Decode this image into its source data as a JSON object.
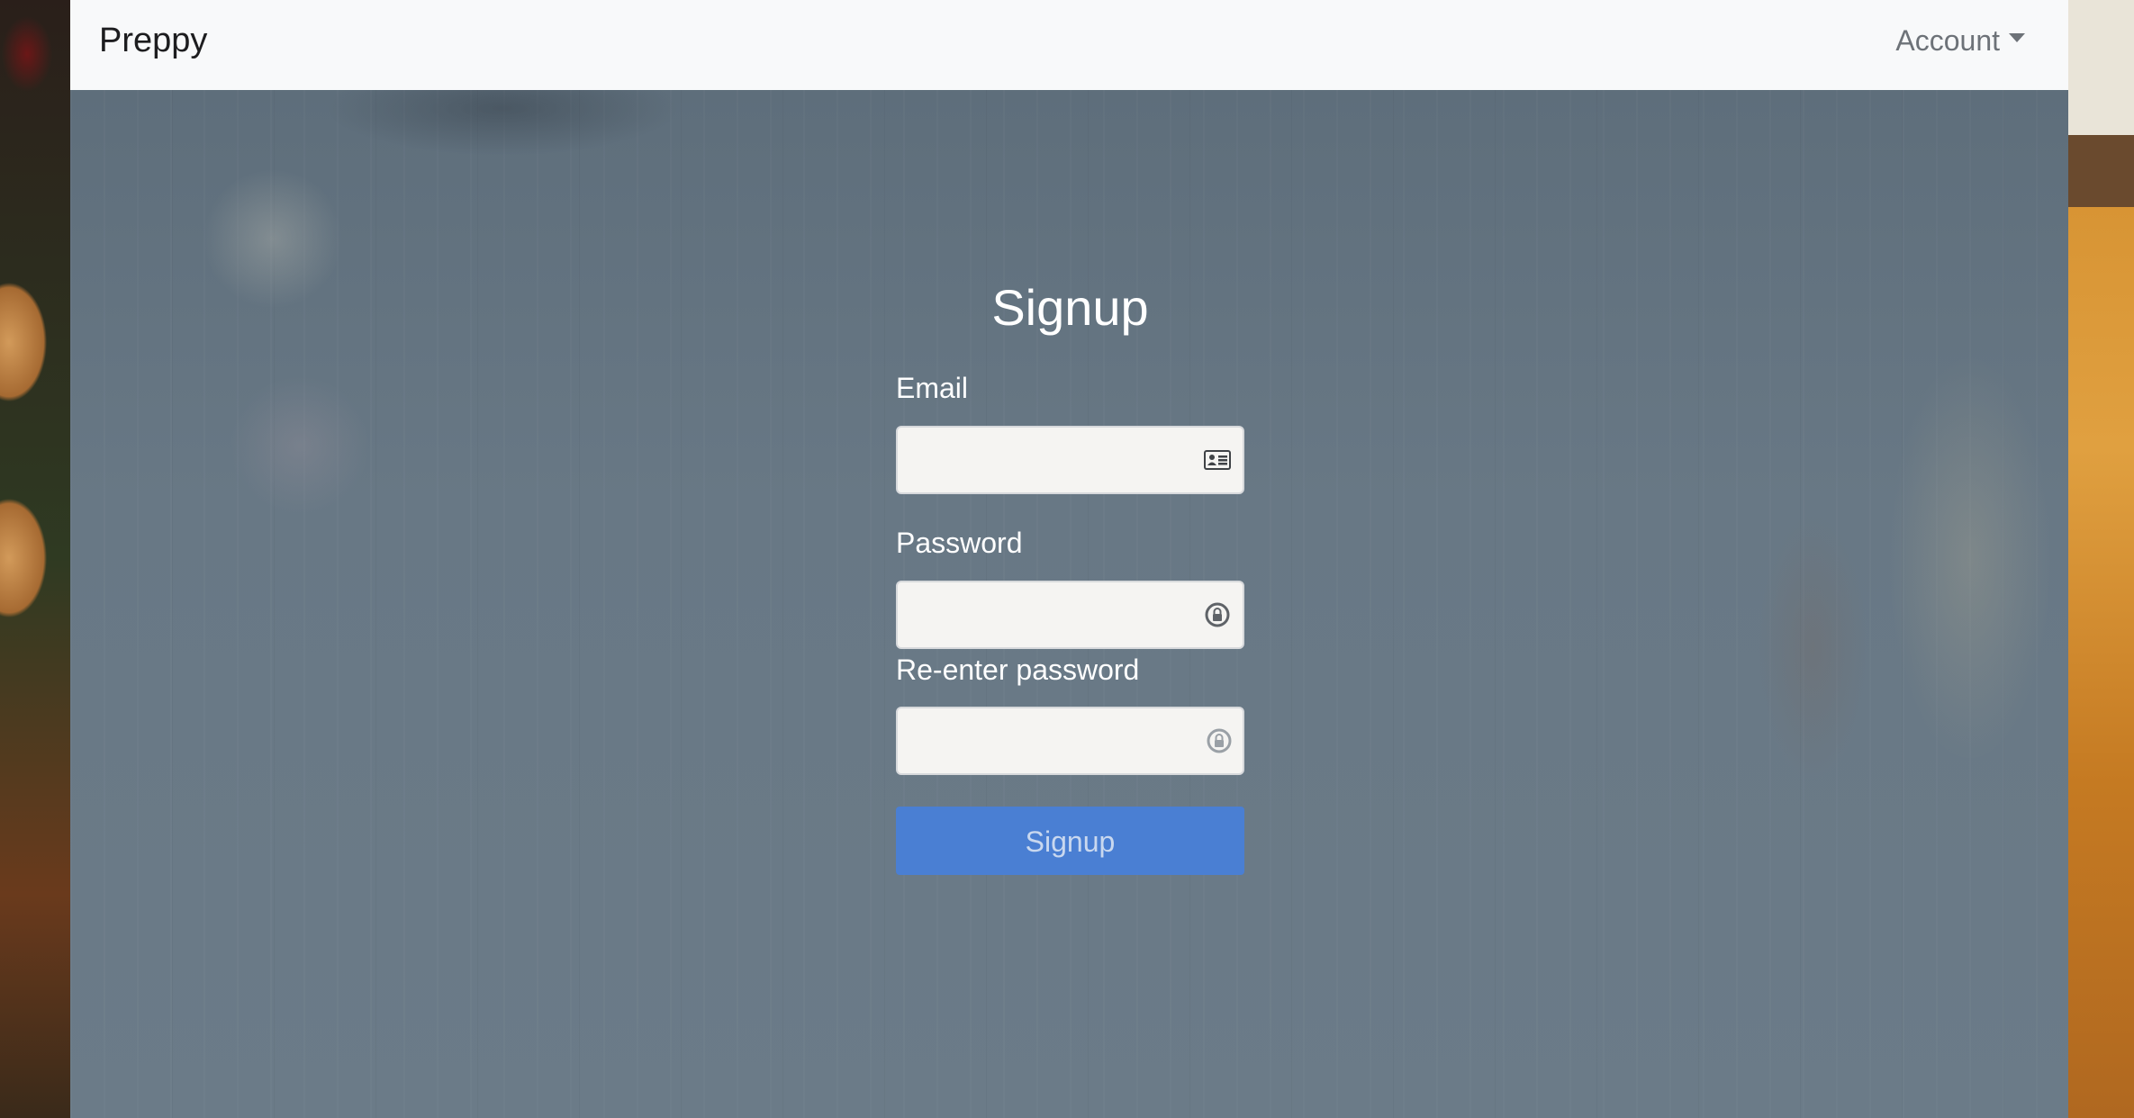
{
  "navbar": {
    "brand": "Preppy",
    "account_label": "Account"
  },
  "signup": {
    "title": "Signup",
    "email_label": "Email",
    "email_value": "",
    "password_label": "Password",
    "password_value": "",
    "reenter_label": "Re-enter password",
    "reenter_value": "",
    "submit_label": "Signup"
  },
  "icons": {
    "email": "id-card-icon",
    "password": "lock-icon",
    "reenter": "lock-icon",
    "account": "caret-down-icon"
  },
  "colors": {
    "navbar_bg": "#f8f9fa",
    "overlay": "#687885",
    "button": "#4a7fd3",
    "button_text": "#c9d8ef"
  }
}
